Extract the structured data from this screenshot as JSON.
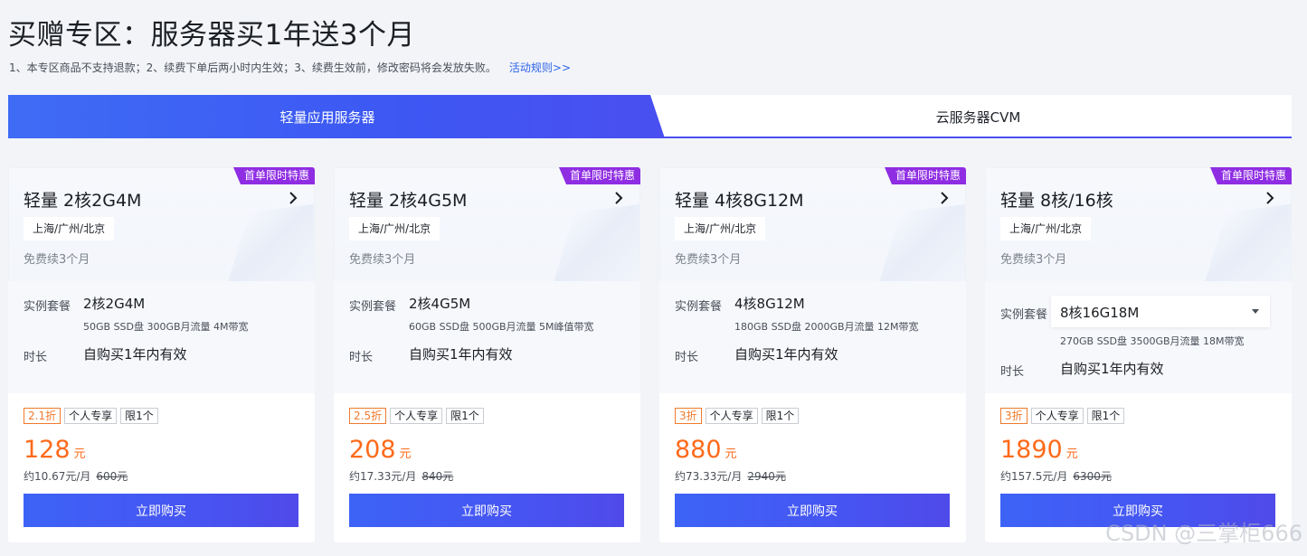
{
  "page": {
    "title": "买赠专区：服务器买1年送3个月",
    "notice": "1、本专区商品不支持退款；2、续费下单后两小时内生效；3、续费生效前，修改密码将会发放失败。",
    "rules_link": "活动规则>>"
  },
  "tabs": [
    {
      "label": "轻量应用服务器",
      "active": true
    },
    {
      "label": "云服务器CVM",
      "active": false
    }
  ],
  "common": {
    "badge": "首单限时特惠",
    "region": "上海/广州/北京",
    "renew_note": "免费续3个月",
    "spec_label": "实例套餐",
    "duration_label": "时长",
    "duration_value": "自购买1年内有效",
    "tag_personal": "个人专享",
    "tag_limit": "限1个",
    "currency_unit": "元",
    "buy_label": "立即购买"
  },
  "cards": [
    {
      "name": "轻量 2核2G4M",
      "spec": "2核2G4M",
      "spec_detail": "50GB SSD盘 300GB月流量 4M带宽",
      "discount": "2.1折",
      "price": "128",
      "per_month": "约10.67元/月",
      "original": "600元"
    },
    {
      "name": "轻量 2核4G5M",
      "spec": "2核4G5M",
      "spec_detail": "60GB SSD盘 500GB月流量 5M峰值带宽",
      "discount": "2.5折",
      "price": "208",
      "per_month": "约17.33元/月",
      "original": "840元"
    },
    {
      "name": "轻量 4核8G12M",
      "spec": "4核8G12M",
      "spec_detail": "180GB SSD盘 2000GB月流量 12M带宽",
      "discount": "3折",
      "price": "880",
      "per_month": "约73.33元/月",
      "original": "2940元"
    },
    {
      "name": "轻量 8核/16核",
      "spec": "8核16G18M",
      "spec_detail": "270GB SSD盘 3500GB月流量 18M带宽",
      "discount": "3折",
      "price": "1890",
      "per_month": "约157.5元/月",
      "original": "6300元"
    }
  ],
  "watermark": "CSDN @三掌柜666",
  "colors": {
    "accent": "#3d5af4",
    "badge": "#8f2de3",
    "price": "#ff6a1a",
    "discount": "#f07a2b"
  }
}
